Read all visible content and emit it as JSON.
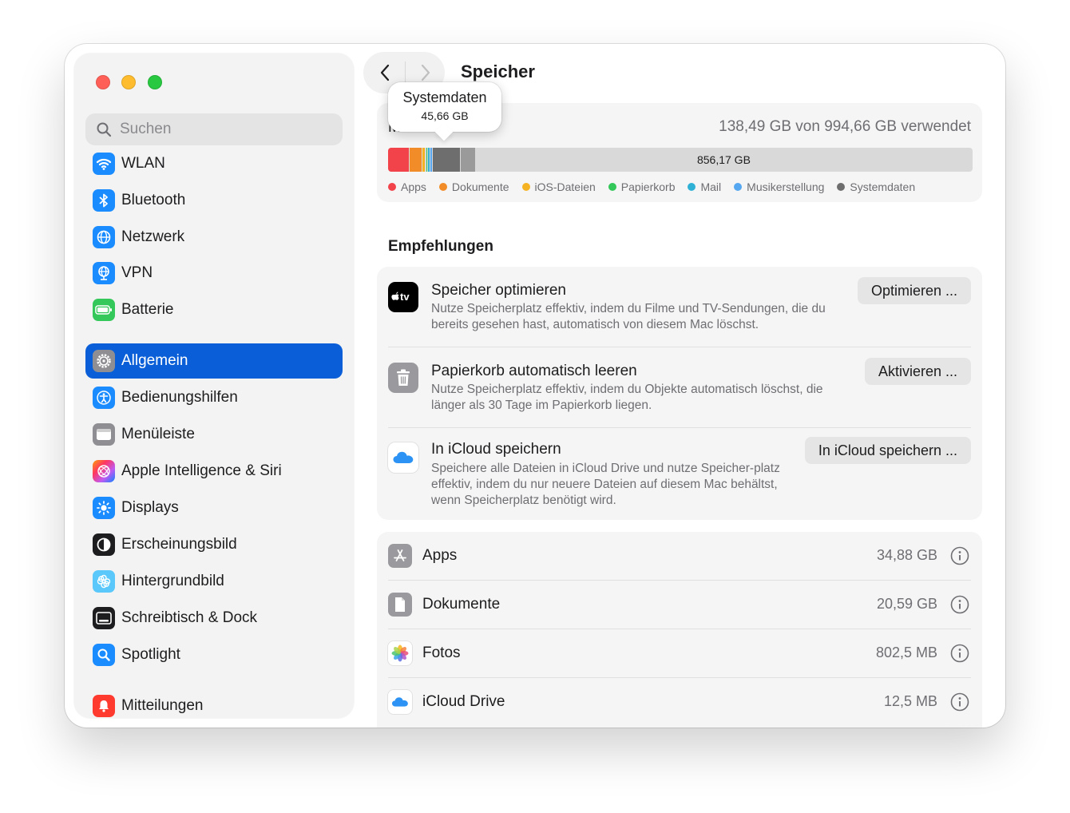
{
  "sidebar": {
    "search_placeholder": "Suchen",
    "items": [
      {
        "label": "WLAN",
        "icon": "wifi-icon"
      },
      {
        "label": "Bluetooth",
        "icon": "bluetooth-icon"
      },
      {
        "label": "Netzwerk",
        "icon": "globe-icon"
      },
      {
        "label": "VPN",
        "icon": "vpn-globe-icon"
      },
      {
        "label": "Batterie",
        "icon": "battery-icon"
      },
      {
        "label": "Allgemein",
        "icon": "gear-icon",
        "active": true
      },
      {
        "label": "Bedienungshilfen",
        "icon": "accessibility-icon"
      },
      {
        "label": "Menüleiste",
        "icon": "menubar-icon"
      },
      {
        "label": "Apple Intelligence & Siri",
        "icon": "siri-icon"
      },
      {
        "label": "Displays",
        "icon": "sun-icon"
      },
      {
        "label": "Erscheinungsbild",
        "icon": "appearance-icon"
      },
      {
        "label": "Hintergrundbild",
        "icon": "flower-icon"
      },
      {
        "label": "Schreibtisch & Dock",
        "icon": "dock-icon"
      },
      {
        "label": "Spotlight",
        "icon": "magnifier-icon"
      },
      {
        "label": "Mitteilungen",
        "icon": "bell-icon"
      }
    ]
  },
  "header": {
    "title": "Speicher"
  },
  "storage": {
    "disk_letter": "M",
    "used_text": "138,49 GB von 994,66 GB verwendet",
    "free_label": "856,17 GB",
    "categories": [
      {
        "name": "Apps",
        "color": "#f2424a",
        "gb": 34.88
      },
      {
        "name": "Dokumente",
        "color": "#f28c28",
        "gb": 20.59
      },
      {
        "name": "iOS-Dateien",
        "color": "#f5b323",
        "gb": 5.0
      },
      {
        "name": "Papierkorb",
        "color": "#34c759",
        "gb": 1.8
      },
      {
        "name": "Mail",
        "color": "#2fb1d6",
        "gb": 3.6
      },
      {
        "name": "Musikerstellung",
        "color": "#54a7f0",
        "gb": 2.5
      },
      {
        "name": "Systemdaten",
        "color": "#6e6e6e",
        "gb": 45.66
      }
    ],
    "other_gb": 24.46,
    "total_gb": 994.66,
    "tooltip": {
      "title": "Systemdaten",
      "value": "45,66 GB"
    }
  },
  "recommendations": {
    "title": "Empfehlungen",
    "items": [
      {
        "title": "Speicher optimieren",
        "desc": "Nutze Speicherplatz effektiv, indem du Filme und TV-Sendungen, die du bereits gesehen hast, automatisch von diesem Mac löschst.",
        "button": "Optimieren ...",
        "icon": "apple-tv-icon"
      },
      {
        "title": "Papierkorb automatisch leeren",
        "desc": "Nutze Speicherplatz effektiv, indem du Objekte automatisch löschst, die länger als 30 Tage im Papierkorb liegen.",
        "button": "Aktivieren ...",
        "icon": "trash-icon"
      },
      {
        "title": "In iCloud speichern",
        "desc": "Speichere alle Dateien in iCloud Drive und nutze Speicher-platz effektiv, indem du nur neuere Dateien auf diesem Mac behältst, wenn Speicherplatz benötigt wird.",
        "button": "In iCloud speichern ...",
        "icon": "icloud-icon"
      }
    ]
  },
  "categories_list": [
    {
      "label": "Apps",
      "size": "34,88 GB",
      "icon": "app-store-icon"
    },
    {
      "label": "Dokumente",
      "size": "20,59 GB",
      "icon": "document-icon"
    },
    {
      "label": "Fotos",
      "size": "802,5 MB",
      "icon": "photos-icon"
    },
    {
      "label": "iCloud Drive",
      "size": "12,5 MB",
      "icon": "icloud-drive-icon"
    }
  ]
}
